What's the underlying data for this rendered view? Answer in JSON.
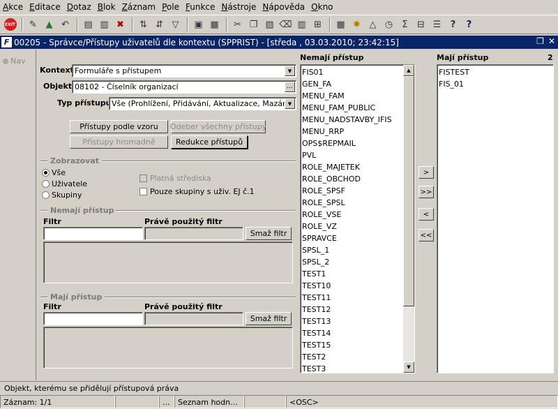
{
  "menu": [
    "Akce",
    "Editace",
    "Dotaz",
    "Blok",
    "Záznam",
    "Pole",
    "Funkce",
    "Nástroje",
    "Nápověda",
    "Okno"
  ],
  "toolbar": {
    "exit_label": "EXIT"
  },
  "window": {
    "title": "00205 - Správce/Přístupy uživatelů dle kontextu (SPPRIST) - [středa , 03.03.2010; 23:42:15]",
    "icon_letter": "F"
  },
  "nav": {
    "label": "Nav"
  },
  "form": {
    "kontext_label": "Kontext",
    "kontext_value": "Formuláře s přístupem",
    "objekt_label": "Objekt",
    "objekt_value": "08102 - Číselník organizací",
    "objekt_lov": "...",
    "typ_label": "Typ přístupu",
    "typ_value": "Vše (Prohlížení, Přidávání, Aktualizace, Mazání)",
    "btn_pristupy_vzor": "Přístupy podle vzoru",
    "btn_odeber_vse": "Odeber všechny přístupy",
    "btn_pristupy_hromadne": "Přístupy hromadně",
    "btn_redukce": "Redukce přístupů"
  },
  "zobrazovat": {
    "title": "Zobrazovat",
    "options": [
      "Vše",
      "Uživatele",
      "Skupiny"
    ],
    "selected": 0,
    "chk_platna": "Platná střediska",
    "chk_pouze": "Pouze skupiny s uživ. EJ č.1"
  },
  "nemaji_filter": {
    "title": "Nemají přístup",
    "filtr_label": "Filtr",
    "pouzity_label": "Právě použitý filtr",
    "clear_btn": "Smaž filtr"
  },
  "maji_filter": {
    "title": "Mají přístup",
    "filtr_label": "Filtr",
    "pouzity_label": "Právě použitý filtr",
    "clear_btn": "Smaž filtr"
  },
  "nemaji_list": {
    "header": "Nemají přístup",
    "items": [
      "FIS01",
      "GEN_FA",
      "MENU_FAM",
      "MENU_FAM_PUBLIC",
      "MENU_NADSTAVBY_IFIS",
      "MENU_RRP",
      "OPS$REPMAIL",
      "PVL",
      "ROLE_MAJETEK",
      "ROLE_OBCHOD",
      "ROLE_SPSF",
      "ROLE_SPSL",
      "ROLE_VSE",
      "ROLE_VZ",
      "SPRAVCE",
      "SPSL_1",
      "SPSL_2",
      "TEST1",
      "TEST10",
      "TEST11",
      "TEST12",
      "TEST13",
      "TEST14",
      "TEST15",
      "TEST2",
      "TEST3"
    ]
  },
  "move_buttons": [
    ">",
    ">>",
    "<",
    "<<"
  ],
  "maji_list": {
    "header": "Mají přístup",
    "count": "2",
    "items": [
      "FISTEST",
      "FIS_01"
    ]
  },
  "hint": "Objekt, kterému se přidělují přístupová práva",
  "status": {
    "zaznam": "Záznam: 1/1",
    "c2": "",
    "c3": "...",
    "seznam": "Seznam hodn...",
    "c5": "",
    "osc": "<OSC>"
  }
}
